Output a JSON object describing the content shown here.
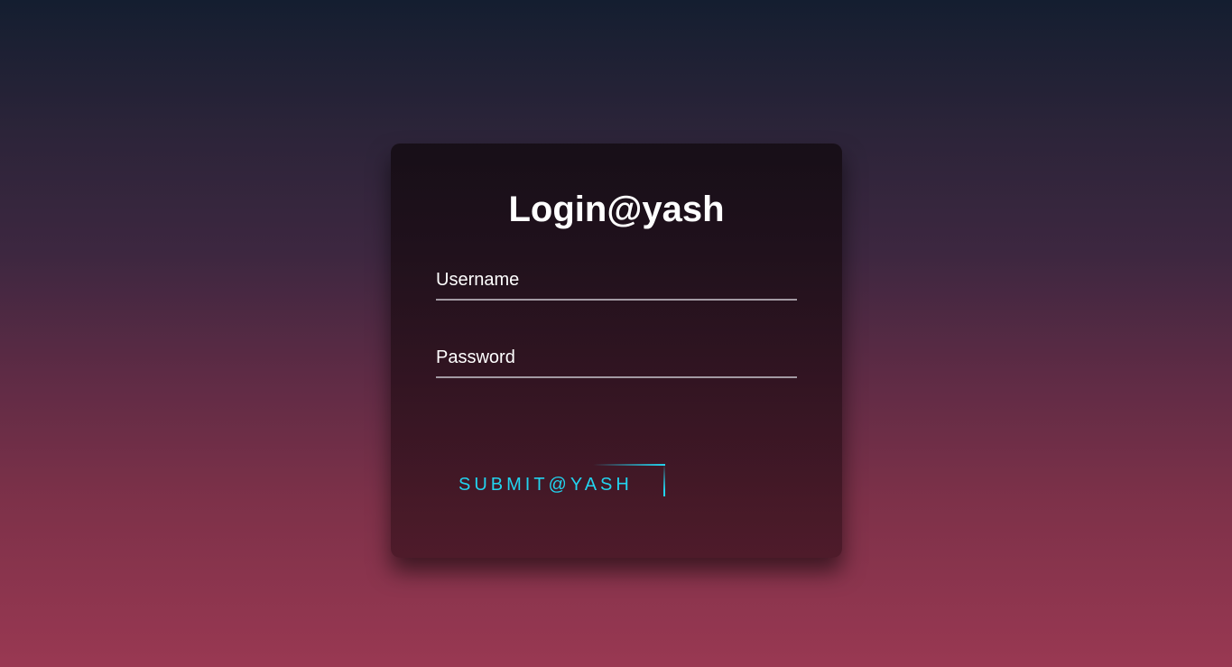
{
  "login": {
    "title": "Login@yash",
    "username": {
      "label": "Username",
      "value": ""
    },
    "password": {
      "label": "Password",
      "value": ""
    },
    "submit_label": "SUBMIT@YASH"
  },
  "colors": {
    "accent": "#22d3ee",
    "title_text": "#ffffff",
    "field_underline": "#a39aa3",
    "background_top": "#141e30",
    "background_bottom": "#993852"
  }
}
